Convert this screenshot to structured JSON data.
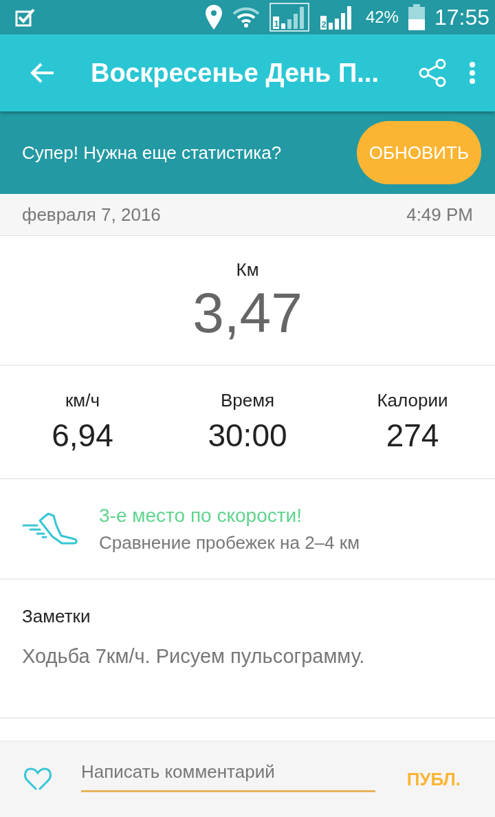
{
  "status_bar": {
    "battery": "42%",
    "time": "17:55",
    "sim_1": "1",
    "sim_2": "2"
  },
  "toolbar": {
    "title": "Воскресенье День П..."
  },
  "banner": {
    "text": "Супер! Нужна еще статистика?",
    "button": "ОБНОВИТЬ"
  },
  "date_row": {
    "date": "февраля 7, 2016",
    "time": "4:49 PM"
  },
  "distance": {
    "label": "Км",
    "value": "3,47"
  },
  "stats": [
    {
      "label": "км/ч",
      "value": "6,94"
    },
    {
      "label": "Время",
      "value": "30:00"
    },
    {
      "label": "Калории",
      "value": "274"
    }
  ],
  "ranking": {
    "title": "3-е место по скорости!",
    "subtitle": "Сравнение пробежек на 2–4 км"
  },
  "notes": {
    "heading": "Заметки",
    "text": "Ходьба 7км/ч. Рисуем пульсограмму."
  },
  "comment_bar": {
    "placeholder": "Написать комментарий",
    "button": "ПУБЛ."
  }
}
